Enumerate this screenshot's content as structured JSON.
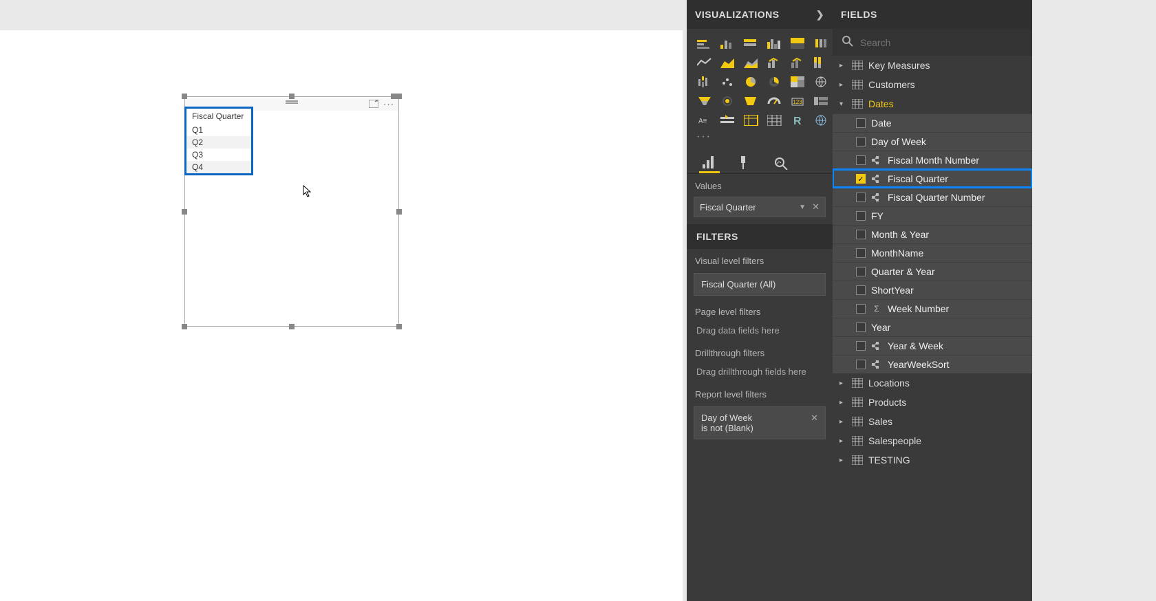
{
  "panels": {
    "viz_title": "VISUALIZATIONS",
    "fields_title": "FIELDS",
    "filters_title": "FILTERS"
  },
  "canvas": {
    "visual": {
      "column_header": "Fiscal Quarter",
      "rows": [
        "Q1",
        "Q2",
        "Q3",
        "Q4"
      ]
    }
  },
  "viz": {
    "values_label": "Values",
    "well": "Fiscal Quarter",
    "visual_filters_label": "Visual level filters",
    "visual_filter_text": "Fiscal Quarter (All)",
    "page_filters_label": "Page level filters",
    "page_drop_text": "Drag data fields here",
    "drill_label": "Drillthrough filters",
    "drill_drop_text": "Drag drillthrough fields here",
    "report_filters_label": "Report level filters",
    "report_filter_name": "Day of Week",
    "report_filter_cond": "is not (Blank)"
  },
  "fields": {
    "search_placeholder": "Search",
    "tables": [
      {
        "name": "Key Measures",
        "expanded": false
      },
      {
        "name": "Customers",
        "expanded": false
      },
      {
        "name": "Dates",
        "expanded": true
      },
      {
        "name": "Locations",
        "expanded": false
      },
      {
        "name": "Products",
        "expanded": false
      },
      {
        "name": "Sales",
        "expanded": false
      },
      {
        "name": "Salespeople",
        "expanded": false
      },
      {
        "name": "TESTING",
        "expanded": false
      }
    ],
    "dates_fields": [
      {
        "name": "Date",
        "checked": false,
        "hier": false
      },
      {
        "name": "Day of Week",
        "checked": false,
        "hier": false
      },
      {
        "name": "Fiscal Month Number",
        "checked": false,
        "hier": true
      },
      {
        "name": "Fiscal Quarter",
        "checked": true,
        "hier": true,
        "highlight": true
      },
      {
        "name": "Fiscal Quarter Number",
        "checked": false,
        "hier": true
      },
      {
        "name": "FY",
        "checked": false,
        "hier": false
      },
      {
        "name": "Month & Year",
        "checked": false,
        "hier": false
      },
      {
        "name": "MonthName",
        "checked": false,
        "hier": false
      },
      {
        "name": "Quarter & Year",
        "checked": false,
        "hier": false
      },
      {
        "name": "ShortYear",
        "checked": false,
        "hier": false
      },
      {
        "name": "Week Number",
        "checked": false,
        "hier": false,
        "sigma": true
      },
      {
        "name": "Year",
        "checked": false,
        "hier": false
      },
      {
        "name": "Year & Week",
        "checked": false,
        "hier": true
      },
      {
        "name": "YearWeekSort",
        "checked": false,
        "hier": true
      }
    ]
  }
}
